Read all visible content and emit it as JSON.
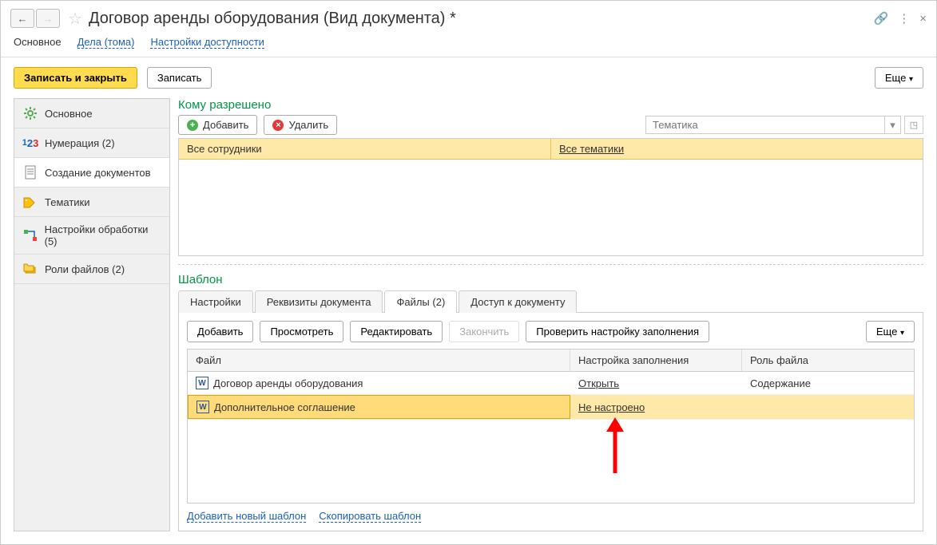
{
  "title": "Договор аренды оборудования (Вид документа) *",
  "topTabs": {
    "main": "Основное",
    "cases": "Дела (тома)",
    "access": "Настройки доступности"
  },
  "toolbar": {
    "saveClose": "Записать и закрыть",
    "save": "Записать",
    "more": "Еще"
  },
  "sidebar": {
    "items": [
      {
        "label": "Основное"
      },
      {
        "label": "Нумерация (2)"
      },
      {
        "label": "Создание документов"
      },
      {
        "label": "Тематики"
      },
      {
        "label": "Настройки обработки (5)"
      },
      {
        "label": "Роли файлов (2)"
      }
    ]
  },
  "permitted": {
    "title": "Кому разрешено",
    "addLabel": "Добавить",
    "deleteLabel": "Удалить",
    "thematicPlaceholder": "Тематика",
    "row": {
      "employees": "Все сотрудники",
      "thematics": "Все тематики"
    }
  },
  "template": {
    "title": "Шаблон",
    "tabs": {
      "settings": "Настройки",
      "requisites": "Реквизиты документа",
      "files": "Файлы (2)",
      "access": "Доступ к документу"
    },
    "buttons": {
      "add": "Добавить",
      "view": "Просмотреть",
      "edit": "Редактировать",
      "finish": "Закончить",
      "check": "Проверить настройку заполнения",
      "more": "Еще"
    },
    "columns": {
      "file": "Файл",
      "setup": "Настройка заполнения",
      "role": "Роль файла"
    },
    "rows": [
      {
        "file": "Договор аренды оборудования",
        "setup": "Открыть",
        "role": "Содержание"
      },
      {
        "file": "Дополнительное соглашение",
        "setup": "Не настроено",
        "role": ""
      }
    ],
    "links": {
      "addNew": "Добавить новый шаблон",
      "copy": "Скопировать шаблон"
    }
  }
}
